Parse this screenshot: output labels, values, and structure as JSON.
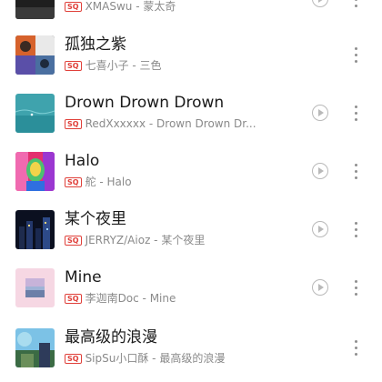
{
  "songs": [
    {
      "title": "",
      "artist_album": "XMASwu - 蒙太奇",
      "quality": "SQ",
      "cover": "dark-cover",
      "has_mv": true
    },
    {
      "title": "孤独之紫",
      "artist_album": "七喜小子 - 三色",
      "quality": "SQ",
      "cover": "collage-cover",
      "has_mv": false
    },
    {
      "title": "Drown Drown Drown",
      "artist_album": "RedXxxxxx - Drown Drown Dr...",
      "quality": "SQ",
      "cover": "ocean-cover",
      "has_mv": true
    },
    {
      "title": "Halo",
      "artist_album": "舵 - Halo",
      "quality": "SQ",
      "cover": "colorful-portrait-cover",
      "has_mv": true
    },
    {
      "title": "某个夜里",
      "artist_album": "JERRYZ/Aioz - 某个夜里",
      "quality": "SQ",
      "cover": "night-city-cover",
      "has_mv": true
    },
    {
      "title": "Mine",
      "artist_album": "李迦南Doc - Mine",
      "quality": "SQ",
      "cover": "pink-landscape-cover",
      "has_mv": true
    },
    {
      "title": "最高级的浪漫",
      "artist_album": "SipSu小口酥 - 最高级的浪漫",
      "quality": "SQ",
      "cover": "sky-street-cover",
      "has_mv": false
    }
  ],
  "icons": {
    "play": "play-circle-icon",
    "more": "more-vertical-icon"
  },
  "colors": {
    "quality_badge": "#e0403a",
    "title": "#1a1a1a",
    "subtitle": "#8a8a8a"
  }
}
